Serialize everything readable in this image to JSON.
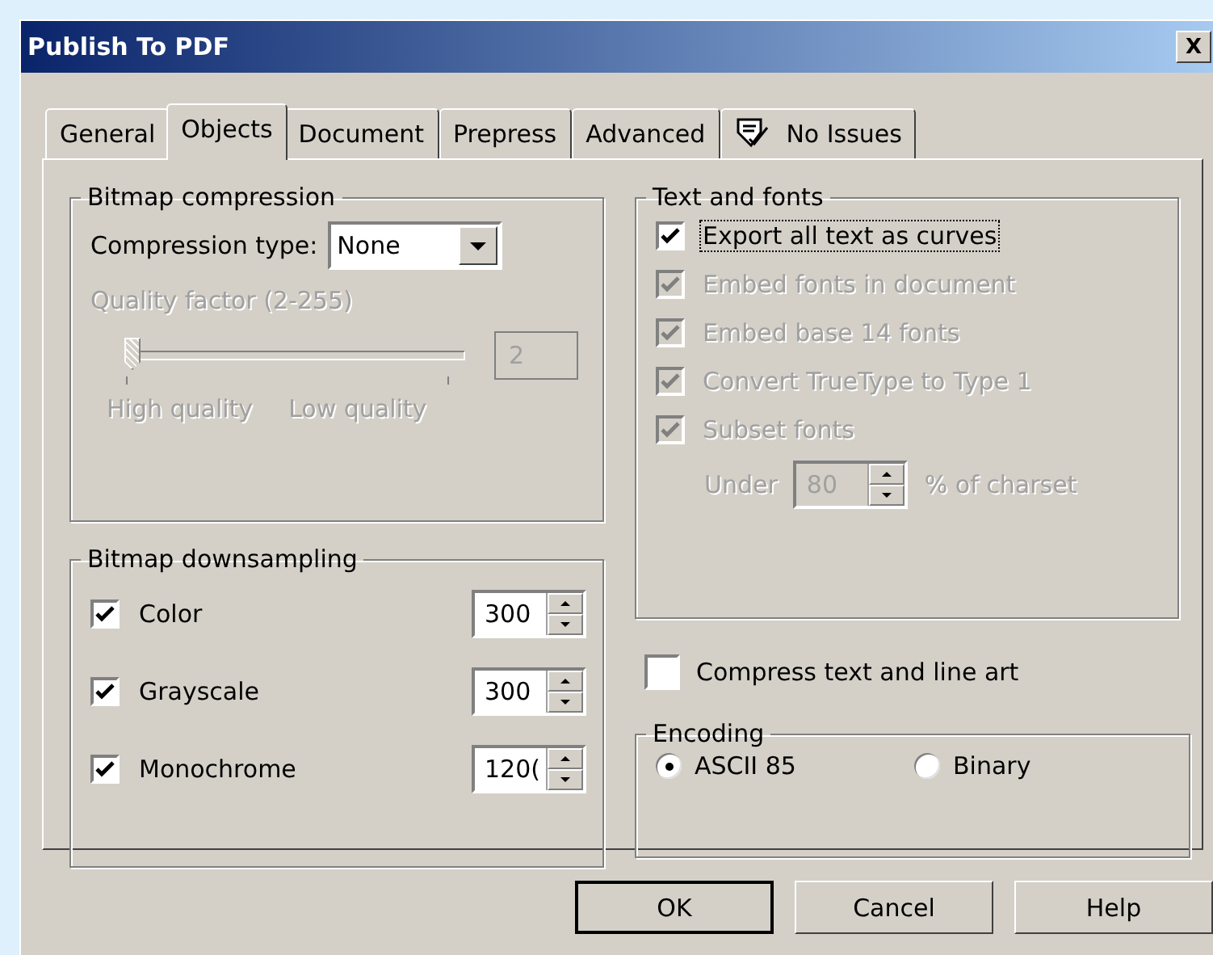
{
  "window": {
    "title": "Publish To PDF",
    "close": "X"
  },
  "tabs": [
    {
      "label": "General",
      "selected": false,
      "kind": "text"
    },
    {
      "label": "Objects",
      "selected": true,
      "kind": "text"
    },
    {
      "label": "Document",
      "selected": false,
      "kind": "text"
    },
    {
      "label": "Prepress",
      "selected": false,
      "kind": "text"
    },
    {
      "label": "Advanced",
      "selected": false,
      "kind": "text"
    },
    {
      "label": "No Issues",
      "selected": false,
      "kind": "issues"
    }
  ],
  "bitmap_compression": {
    "title": "Bitmap compression",
    "compression_type": {
      "label": "Compression type:",
      "value": "None"
    },
    "quality": {
      "label": "Quality factor (2-255)",
      "disabled": true,
      "level": 0,
      "value": "2",
      "min_label": "High quality",
      "max_label": "Low quality"
    }
  },
  "bitmap_downsampling": {
    "title": "Bitmap downsampling",
    "rows": [
      {
        "label": "Color",
        "checked": true,
        "value": "300"
      },
      {
        "label": "Grayscale",
        "checked": true,
        "value": "300"
      },
      {
        "label": "Monochrome",
        "checked": true,
        "value": "120("
      }
    ]
  },
  "text_and_fonts": {
    "title": "Text and fonts",
    "options": [
      {
        "label": "Export all text as curves",
        "checked": true,
        "disabled": false,
        "focused": true
      },
      {
        "label": "Embed fonts in document",
        "checked": true,
        "disabled": true,
        "focused": false
      },
      {
        "label": "Embed base 14 fonts",
        "checked": true,
        "disabled": true,
        "focused": false
      },
      {
        "label": "Convert TrueType to Type 1",
        "checked": true,
        "disabled": true,
        "focused": false
      },
      {
        "label": "Subset fonts",
        "checked": true,
        "disabled": true,
        "focused": false
      }
    ],
    "under": {
      "label": "Under",
      "value": "80",
      "suffix": "% of charset",
      "disabled": true
    }
  },
  "compress_text": {
    "label": "Compress text and line art",
    "checked": false
  },
  "encoding": {
    "title": "Encoding",
    "options": [
      {
        "label": "ASCII 85",
        "selected": true
      },
      {
        "label": "Binary",
        "selected": false
      }
    ]
  },
  "buttons": [
    {
      "label": "OK",
      "default": true
    },
    {
      "label": "Cancel",
      "default": false
    },
    {
      "label": "Help",
      "default": false
    }
  ]
}
